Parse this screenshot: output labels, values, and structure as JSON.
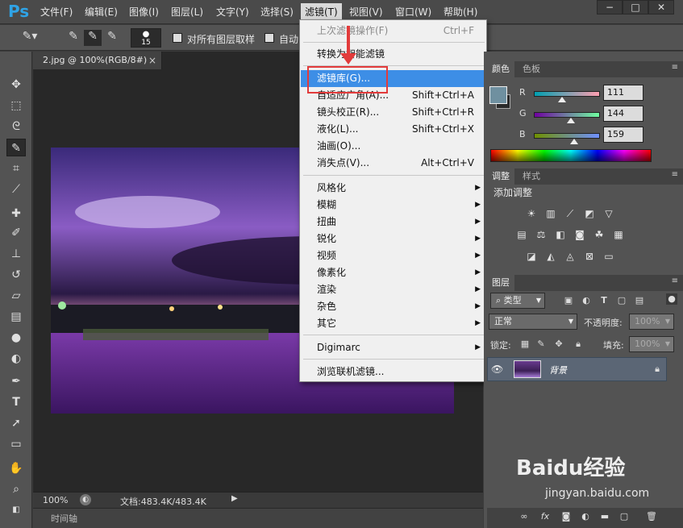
{
  "app": {
    "logo": "Ps"
  },
  "menubar": {
    "items": [
      "文件(F)",
      "编辑(E)",
      "图像(I)",
      "图层(L)",
      "文字(Y)",
      "选择(S)",
      "滤镜(T)",
      "视图(V)",
      "窗口(W)",
      "帮助(H)"
    ],
    "active_index": 6,
    "window_controls": [
      "−",
      "□",
      "✕"
    ]
  },
  "options": {
    "brush_size": "15",
    "sample_all_label": "对所有图层取样",
    "auto_label": "自动"
  },
  "document": {
    "tab_title": "2.jpg @ 100%(RGB/8#)",
    "tab_close": "×",
    "zoom": "100%",
    "doc_info": "文档:483.4K/483.4K",
    "timeline_label": "时间轴"
  },
  "filter_menu": {
    "items": [
      {
        "label": "上次滤镜操作(F)",
        "shortcut": "Ctrl+F",
        "disabled": true
      },
      {
        "label": "转换为智能滤镜",
        "shortcut": ""
      },
      {
        "label": "滤镜库(G)...",
        "shortcut": "",
        "highlight": true
      },
      {
        "label": "自适应广角(A)...",
        "shortcut": "Shift+Ctrl+A"
      },
      {
        "label": "镜头校正(R)...",
        "shortcut": "Shift+Ctrl+R"
      },
      {
        "label": "液化(L)...",
        "shortcut": "Shift+Ctrl+X"
      },
      {
        "label": "油画(O)...",
        "shortcut": ""
      },
      {
        "label": "消失点(V)...",
        "shortcut": "Alt+Ctrl+V"
      },
      {
        "label": "风格化",
        "submenu": true
      },
      {
        "label": "模糊",
        "submenu": true
      },
      {
        "label": "扭曲",
        "submenu": true
      },
      {
        "label": "锐化",
        "submenu": true
      },
      {
        "label": "视频",
        "submenu": true
      },
      {
        "label": "像素化",
        "submenu": true
      },
      {
        "label": "渲染",
        "submenu": true
      },
      {
        "label": "杂色",
        "submenu": true
      },
      {
        "label": "其它",
        "submenu": true
      },
      {
        "label": "Digimarc",
        "submenu": true
      },
      {
        "label": "浏览联机滤镜..."
      }
    ]
  },
  "color_panel": {
    "tabs": [
      "颜色",
      "色板"
    ],
    "channels": [
      {
        "label": "R",
        "value": "111"
      },
      {
        "label": "G",
        "value": "144"
      },
      {
        "label": "B",
        "value": "159"
      }
    ]
  },
  "adjust_panel": {
    "tabs": [
      "调整",
      "样式"
    ],
    "title": "添加调整"
  },
  "layers_panel": {
    "tab": "图层",
    "filter_type": "类型",
    "blend_mode": "正常",
    "opacity_label": "不透明度:",
    "opacity_value": "100%",
    "lock_label": "锁定:",
    "fill_label": "填充:",
    "fill_value": "100%",
    "layer_name": "背景"
  },
  "watermark": {
    "brand": "Baidu经验",
    "url": "jingyan.baidu.com"
  },
  "colors": {
    "highlight": "#3d8ee6",
    "annotation": "#e23b3b",
    "accent": "#2fa3e6"
  }
}
